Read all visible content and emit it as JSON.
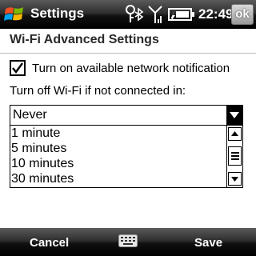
{
  "header": {
    "app_title": "Settings",
    "clock": "22:49",
    "ok_label": "ok",
    "icons": [
      "windows-start-icon",
      "bluetooth-wifi-icon",
      "signal-strength-icon",
      "battery-icon"
    ]
  },
  "page": {
    "title": "Wi-Fi Advanced Settings"
  },
  "form": {
    "notification_checkbox": {
      "label": "Turn on available network notification",
      "checked": true
    },
    "timeout": {
      "label": "Turn off Wi-Fi if not connected in:",
      "selected": "Never",
      "options": [
        "1 minute",
        "5 minutes",
        "10 minutes",
        "30 minutes"
      ]
    }
  },
  "softkeys": {
    "left": "Cancel",
    "right": "Save",
    "center_icon": "keyboard-icon"
  }
}
